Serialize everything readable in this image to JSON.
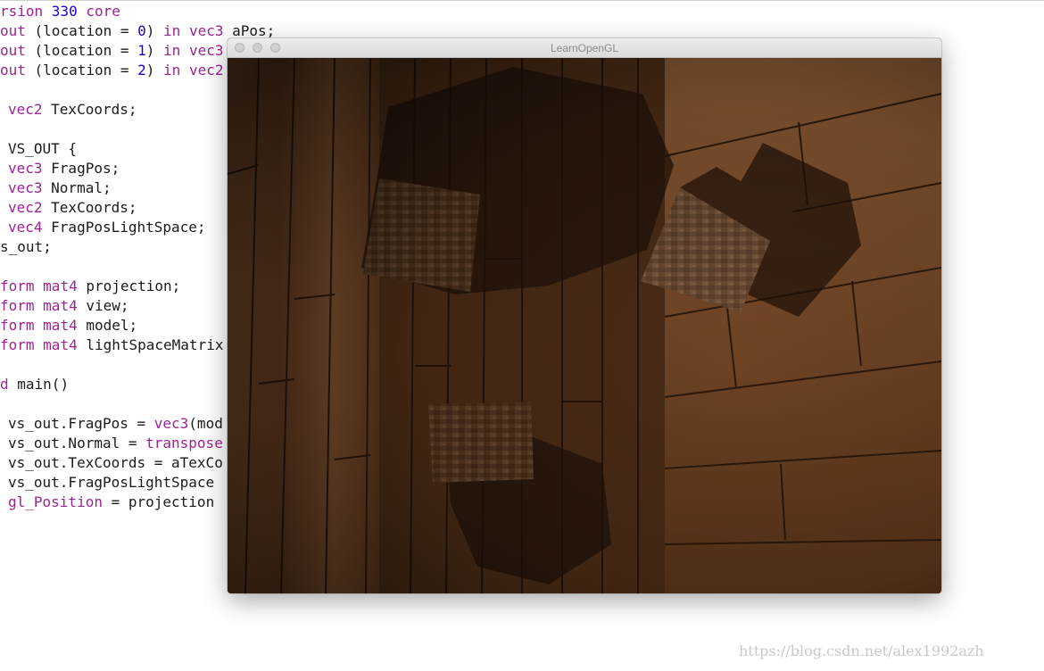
{
  "editor": {
    "lines": [
      {
        "indent": false,
        "tokens": [
          {
            "t": "rsion ",
            "c": "kw"
          },
          {
            "t": "330",
            "c": "num"
          },
          {
            "t": " core",
            "c": "kw"
          }
        ]
      },
      {
        "indent": false,
        "tokens": [
          {
            "t": "out",
            "c": "kw"
          },
          {
            "t": " (location = ",
            "c": ""
          },
          {
            "t": "0",
            "c": "num"
          },
          {
            "t": ") ",
            "c": ""
          },
          {
            "t": "in",
            "c": "kw"
          },
          {
            "t": " ",
            "c": ""
          },
          {
            "t": "vec3",
            "c": "kw"
          },
          {
            "t": " aPos;",
            "c": ""
          }
        ]
      },
      {
        "indent": false,
        "tokens": [
          {
            "t": "out",
            "c": "kw"
          },
          {
            "t": " (location = ",
            "c": ""
          },
          {
            "t": "1",
            "c": "num"
          },
          {
            "t": ") ",
            "c": ""
          },
          {
            "t": "in",
            "c": "kw"
          },
          {
            "t": " ",
            "c": ""
          },
          {
            "t": "vec3",
            "c": "kw"
          }
        ]
      },
      {
        "indent": false,
        "tokens": [
          {
            "t": "out",
            "c": "kw"
          },
          {
            "t": " (location = ",
            "c": ""
          },
          {
            "t": "2",
            "c": "num"
          },
          {
            "t": ") ",
            "c": ""
          },
          {
            "t": "in",
            "c": "kw"
          },
          {
            "t": " ",
            "c": ""
          },
          {
            "t": "vec2",
            "c": "kw"
          }
        ]
      },
      {
        "indent": false,
        "tokens": []
      },
      {
        "indent": true,
        "tokens": [
          {
            "t": "vec2",
            "c": "kw"
          },
          {
            "t": " TexCoords;",
            "c": ""
          }
        ]
      },
      {
        "indent": false,
        "tokens": []
      },
      {
        "indent": true,
        "tokens": [
          {
            "t": "VS_OUT {",
            "c": ""
          }
        ]
      },
      {
        "indent": true,
        "tokens": [
          {
            "t": "vec3",
            "c": "kw"
          },
          {
            "t": " FragPos;",
            "c": ""
          }
        ]
      },
      {
        "indent": true,
        "tokens": [
          {
            "t": "vec3",
            "c": "kw"
          },
          {
            "t": " Normal;",
            "c": ""
          }
        ]
      },
      {
        "indent": true,
        "tokens": [
          {
            "t": "vec2",
            "c": "kw"
          },
          {
            "t": " TexCoords;",
            "c": ""
          }
        ]
      },
      {
        "indent": true,
        "tokens": [
          {
            "t": "vec4",
            "c": "kw"
          },
          {
            "t": " FragPosLightSpace;",
            "c": ""
          }
        ]
      },
      {
        "indent": false,
        "tokens": [
          {
            "t": "s_out;",
            "c": ""
          }
        ]
      },
      {
        "indent": false,
        "tokens": []
      },
      {
        "indent": false,
        "tokens": [
          {
            "t": "form",
            "c": "kw"
          },
          {
            "t": " ",
            "c": ""
          },
          {
            "t": "mat4",
            "c": "kw"
          },
          {
            "t": " projection;",
            "c": ""
          }
        ]
      },
      {
        "indent": false,
        "tokens": [
          {
            "t": "form",
            "c": "kw"
          },
          {
            "t": " ",
            "c": ""
          },
          {
            "t": "mat4",
            "c": "kw"
          },
          {
            "t": " view;",
            "c": ""
          }
        ]
      },
      {
        "indent": false,
        "tokens": [
          {
            "t": "form",
            "c": "kw"
          },
          {
            "t": " ",
            "c": ""
          },
          {
            "t": "mat4",
            "c": "kw"
          },
          {
            "t": " model;",
            "c": ""
          }
        ]
      },
      {
        "indent": false,
        "tokens": [
          {
            "t": "form",
            "c": "kw"
          },
          {
            "t": " ",
            "c": ""
          },
          {
            "t": "mat4",
            "c": "kw"
          },
          {
            "t": " lightSpaceMatrix",
            "c": ""
          }
        ]
      },
      {
        "indent": false,
        "tokens": []
      },
      {
        "indent": false,
        "tokens": [
          {
            "t": "d",
            "c": "kw"
          },
          {
            "t": " main()",
            "c": ""
          }
        ]
      },
      {
        "indent": false,
        "tokens": []
      },
      {
        "indent": true,
        "tokens": [
          {
            "t": "vs_out.FragPos = ",
            "c": ""
          },
          {
            "t": "vec3",
            "c": "kw"
          },
          {
            "t": "(mod",
            "c": ""
          }
        ]
      },
      {
        "indent": true,
        "tokens": [
          {
            "t": "vs_out.Normal = ",
            "c": ""
          },
          {
            "t": "transpose",
            "c": "kw"
          }
        ]
      },
      {
        "indent": true,
        "tokens": [
          {
            "t": "vs_out.TexCoords = aTexCo",
            "c": ""
          }
        ]
      },
      {
        "indent": true,
        "tokens": [
          {
            "t": "vs_out.FragPosLightSpace",
            "c": ""
          }
        ]
      },
      {
        "indent": true,
        "tokens": [
          {
            "t": "gl_Position",
            "c": "kw"
          },
          {
            "t": " = projection",
            "c": ""
          }
        ]
      }
    ]
  },
  "window": {
    "title": "LearnOpenGL"
  },
  "watermark": "https://blog.csdn.net/alex1992azh",
  "colors": {
    "keyword": "#9b2393",
    "number": "#1c00cf",
    "text": "#1b1b1b",
    "wood_light": "#8a5a35",
    "wood_dark": "#2a180c"
  }
}
